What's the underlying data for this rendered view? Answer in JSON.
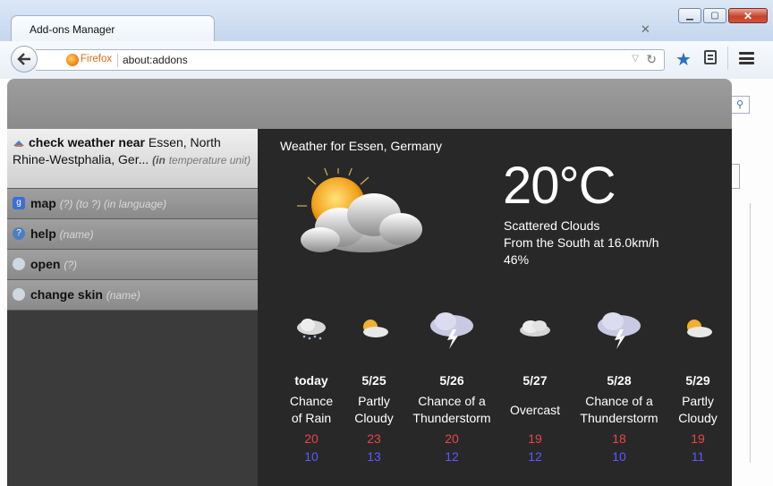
{
  "window": {
    "tab_title": "Add-ons Manager"
  },
  "navbar": {
    "identity_label": "Firefox",
    "url": "about:addons"
  },
  "commands": [
    {
      "name": "check weather near",
      "rest": "Essen, North Rhine-Westphalia, Ger...",
      "arg_prefix": "(in",
      "arg_name": "temperature unit)"
    },
    {
      "name": "map",
      "args": "(?) (to ?) (in language)"
    },
    {
      "name": "help",
      "args": "(name)"
    },
    {
      "name": "open",
      "args": "(?)"
    },
    {
      "name": "change skin",
      "args": "(name)"
    }
  ],
  "weather": {
    "heading": "Weather for Essen, Germany",
    "temperature": "20°C",
    "condition": "Scattered Clouds",
    "wind": "From the South at 16.0km/h",
    "humidity": "46%",
    "forecast": [
      {
        "day": "today",
        "cond": "Chance of Rain",
        "hi": "20",
        "lo": "10",
        "icon": "rain-cloud-icon"
      },
      {
        "day": "5/25",
        "cond": "Partly Cloudy",
        "hi": "23",
        "lo": "13",
        "icon": "partly-cloudy-icon"
      },
      {
        "day": "5/26",
        "cond": "Chance of a Thunderstorm",
        "hi": "20",
        "lo": "12",
        "icon": "thunderstorm-icon"
      },
      {
        "day": "5/27",
        "cond": "Overcast",
        "hi": "19",
        "lo": "12",
        "icon": "overcast-icon"
      },
      {
        "day": "5/28",
        "cond": "Chance of a Thunderstorm",
        "hi": "18",
        "lo": "10",
        "icon": "thunderstorm-icon"
      },
      {
        "day": "5/29",
        "cond": "Partly Cloudy",
        "hi": "19",
        "lo": "11",
        "icon": "partly-cloudy-icon"
      }
    ]
  },
  "colors": {
    "high_temp": "#ee4444",
    "low_temp": "#5a5aff",
    "panel_bg": "#282828"
  }
}
